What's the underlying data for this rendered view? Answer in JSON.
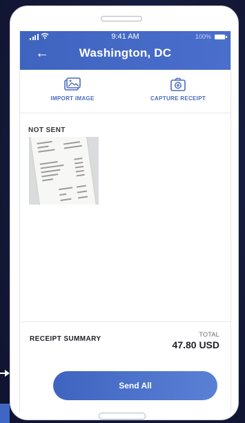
{
  "status_bar": {
    "time": "9:41 AM",
    "battery": "100%"
  },
  "header": {
    "title": "Washington, DC"
  },
  "actions": {
    "import_label": "IMPORT IMAGE",
    "capture_label": "CAPTURE RECEIPT"
  },
  "section": {
    "not_sent_label": "NOT SENT"
  },
  "summary": {
    "label": "RECEIPT SUMMARY",
    "total_label": "TOTAL",
    "total_value": "47.80 USD"
  },
  "send_button": {
    "label": "Send All"
  },
  "colors": {
    "accent": "#4a6ecb",
    "background": "#151a3a"
  },
  "icons": {
    "back": "back-arrow-icon",
    "import": "image-icon",
    "capture": "camera-icon",
    "signal": "signal-icon",
    "wifi": "wifi-icon",
    "battery": "battery-icon"
  }
}
